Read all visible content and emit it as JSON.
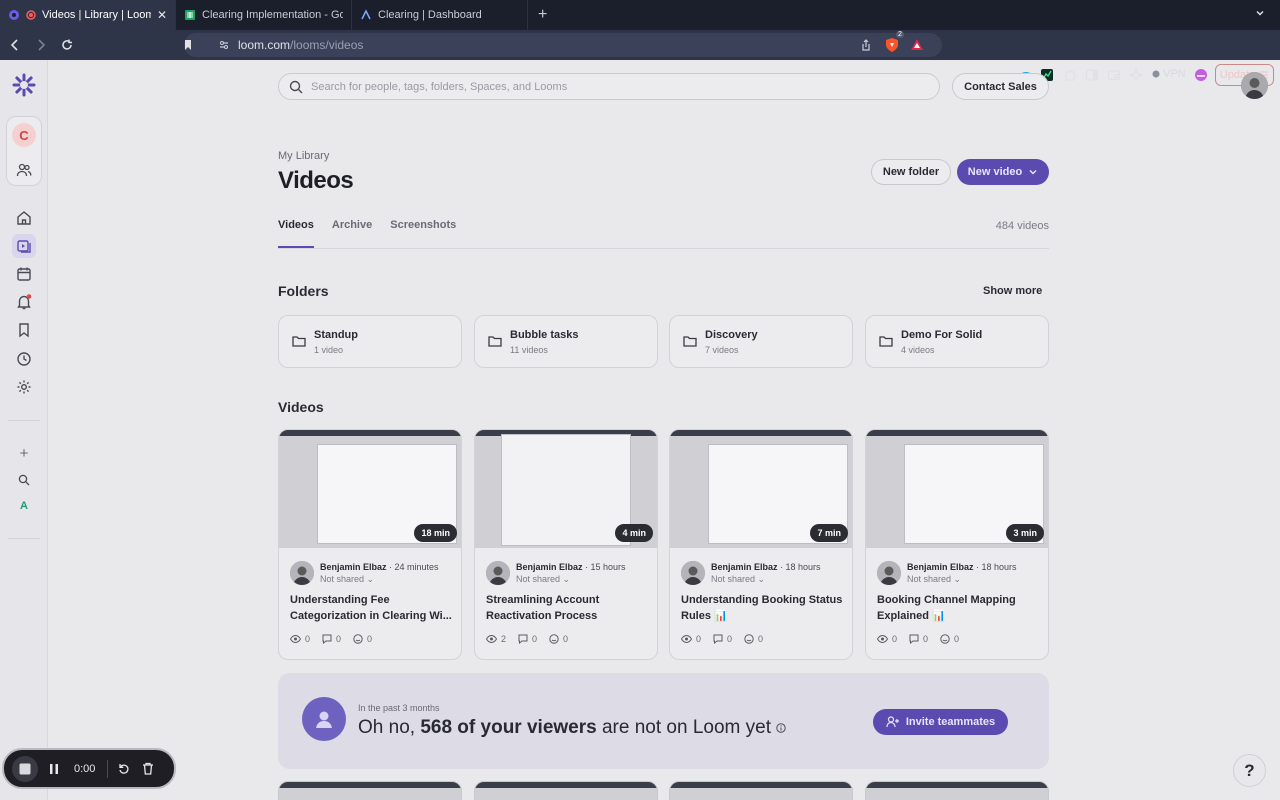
{
  "browser": {
    "tabs": [
      {
        "title": "Videos | Library | Loom",
        "active": true,
        "icon": "loom-icon"
      },
      {
        "title": "Clearing Implementation - Google Sheets",
        "active": false,
        "icon": "sheets-icon"
      },
      {
        "title": "Clearing | Dashboard",
        "active": false,
        "icon": "dashboard-icon"
      }
    ],
    "url_host": "loom.com",
    "url_path": "/looms/videos",
    "brave_badge": "2",
    "vpn_label": "VPN",
    "update_label": "Update"
  },
  "rail": {
    "workspace_initial": "C",
    "bottom_initial": "A"
  },
  "search": {
    "placeholder": "Search for people, tags, folders, Spaces, and Looms"
  },
  "header": {
    "contact_sales": "Contact Sales",
    "breadcrumb": "My Library",
    "title": "Videos",
    "new_folder": "New folder",
    "new_video": "New video"
  },
  "tabs": [
    {
      "label": "Videos",
      "active": true
    },
    {
      "label": "Archive",
      "active": false
    },
    {
      "label": "Screenshots",
      "active": false
    }
  ],
  "video_count": "484 videos",
  "folders_section": {
    "heading": "Folders",
    "show_more": "Show more",
    "items": [
      {
        "name": "Standup",
        "count": "1 video"
      },
      {
        "name": "Bubble tasks",
        "count": "11 videos"
      },
      {
        "name": "Discovery",
        "count": "7 videos"
      },
      {
        "name": "Demo For Solid",
        "count": "4 videos"
      }
    ]
  },
  "videos_section": {
    "heading": "Videos",
    "items": [
      {
        "duration": "18 min",
        "author": "Benjamin Elbaz",
        "time": "24 minutes",
        "sharing": "Not shared",
        "title": "Understanding Fee Categorization in Clearing Wi...",
        "views": "0",
        "comments": "0",
        "reactions": "0"
      },
      {
        "duration": "4 min",
        "author": "Benjamin Elbaz",
        "time": "15 hours",
        "sharing": "Not shared",
        "title": "Streamlining Account Reactivation Process",
        "views": "2",
        "comments": "0",
        "reactions": "0"
      },
      {
        "duration": "7 min",
        "author": "Benjamin Elbaz",
        "time": "18 hours",
        "sharing": "Not shared",
        "title": "Understanding Booking Status Rules 📊",
        "views": "0",
        "comments": "0",
        "reactions": "0"
      },
      {
        "duration": "3 min",
        "author": "Benjamin Elbaz",
        "time": "18 hours",
        "sharing": "Not shared",
        "title": "Booking Channel Mapping Explained 📊",
        "views": "0",
        "comments": "0",
        "reactions": "0"
      }
    ]
  },
  "banner": {
    "subtitle": "In the past 3 months",
    "text_prefix": "Oh no,",
    "text_bold": "568 of your viewers",
    "text_suffix": "are not on Loom yet",
    "button": "Invite teammates"
  },
  "recorder": {
    "time": "0:00"
  },
  "help": "?",
  "colors": {
    "accent": "#5b4bb0",
    "page_bg": "#e9e9ec",
    "chrome_bg": "#1b1f2b"
  }
}
